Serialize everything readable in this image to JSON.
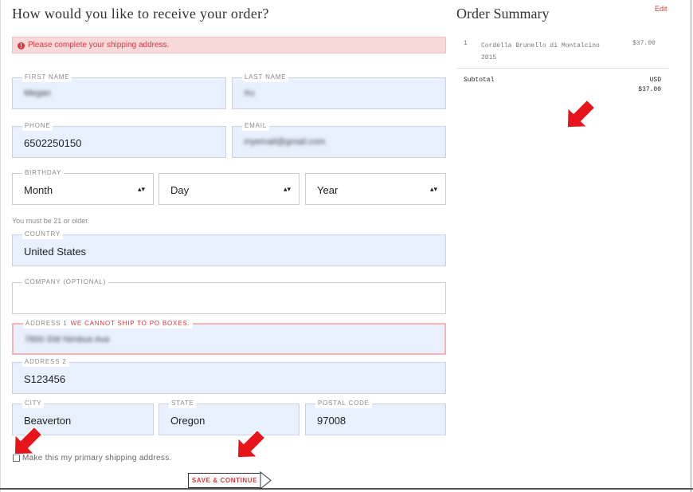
{
  "form": {
    "title": "How would you like to receive your order?",
    "alert": "Please complete your shipping address.",
    "alert_icon": "alert-circle-icon",
    "first_name": {
      "label": "FIRST NAME",
      "value": "Megan"
    },
    "last_name": {
      "label": "LAST NAME",
      "value": "Xu"
    },
    "phone": {
      "label": "PHONE",
      "value": "6502250150"
    },
    "email": {
      "label": "EMAIL",
      "value": "myemail@gmail.com"
    },
    "birthday": {
      "label": "BIRTHDAY",
      "month": "Month",
      "day": "Day",
      "year": "Year"
    },
    "age_note": "You must be 21 or older.",
    "country": {
      "label": "COUNTRY",
      "value": "United States"
    },
    "company": {
      "label": "COMPANY (OPTIONAL)",
      "value": ""
    },
    "address1": {
      "label": "ADDRESS 1",
      "error": "WE CANNOT SHIP TO PO BOXES.",
      "value": "7800 SW Nimbus Ave"
    },
    "address2": {
      "label": "ADDRESS 2",
      "value": "S123456"
    },
    "city": {
      "label": "CITY",
      "value": "Beaverton"
    },
    "state": {
      "label": "STATE",
      "value": "Oregon"
    },
    "postal": {
      "label": "POSTAL CODE",
      "value": "97008"
    },
    "primary_checkbox_label": "Make this my primary shipping address.",
    "save_button": "SAVE & CONTINUE"
  },
  "summary": {
    "title": "Order Summary",
    "edit_link": "Edit",
    "items": [
      {
        "qty": "1",
        "name": "Cordella Brunello di Montalcino 2015",
        "price": "$37.00"
      }
    ],
    "subtotal_label": "Subtotal",
    "subtotal_currency": "USD",
    "subtotal_value": "$37.00"
  },
  "colors": {
    "accent_red": "#d9363e",
    "autofill_blue": "#e8f0fe",
    "annotation_arrow": "#e8141c"
  }
}
